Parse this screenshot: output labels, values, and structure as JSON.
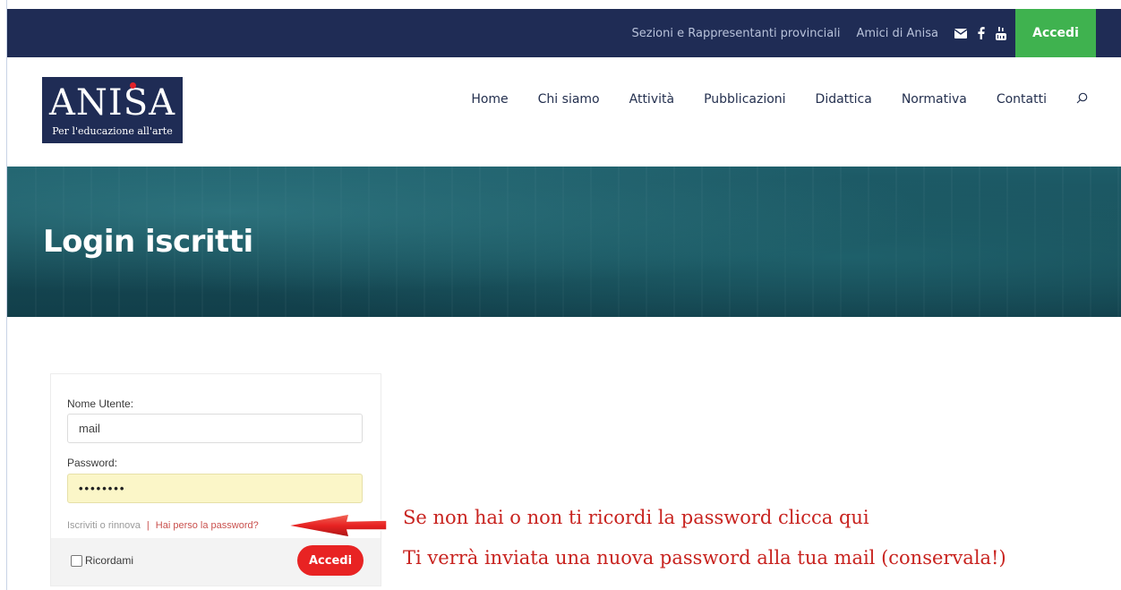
{
  "topbar": {
    "link_sections": "Sezioni e Rappresentanti provinciali",
    "link_friends": "Amici di Anisa",
    "login_button": "Accedi"
  },
  "logo": {
    "wordmark": "ANISA",
    "tagline": "Per l'educazione all'arte"
  },
  "nav": {
    "items": [
      {
        "label": "Home"
      },
      {
        "label": "Chi siamo"
      },
      {
        "label": "Attività"
      },
      {
        "label": "Pubblicazioni"
      },
      {
        "label": "Didattica"
      },
      {
        "label": "Normativa"
      },
      {
        "label": "Contatti"
      }
    ]
  },
  "hero": {
    "title": "Login iscritti"
  },
  "login_form": {
    "username_label": "Nome Utente:",
    "username_value": "mail",
    "password_label": "Password:",
    "password_value": "••••••••",
    "register_link": "Iscriviti o rinnova",
    "separator": "|",
    "lost_password_link": "Hai perso la password?",
    "remember_label": "Ricordami",
    "submit_label": "Accedi"
  },
  "annotation": {
    "line1": "Se non hai o non ti ricordi la password clicca qui",
    "line2": "Ti verrà inviata una nuova password alla tua mail (conservala!)"
  },
  "icons": {
    "mail": "mail-icon",
    "facebook": "facebook-icon",
    "youtube": "youtube-icon",
    "search": "search-icon"
  },
  "colors": {
    "navy": "#1f2c55",
    "green": "#3fb24f",
    "red": "#e82323",
    "annotation": "#c8231f"
  }
}
